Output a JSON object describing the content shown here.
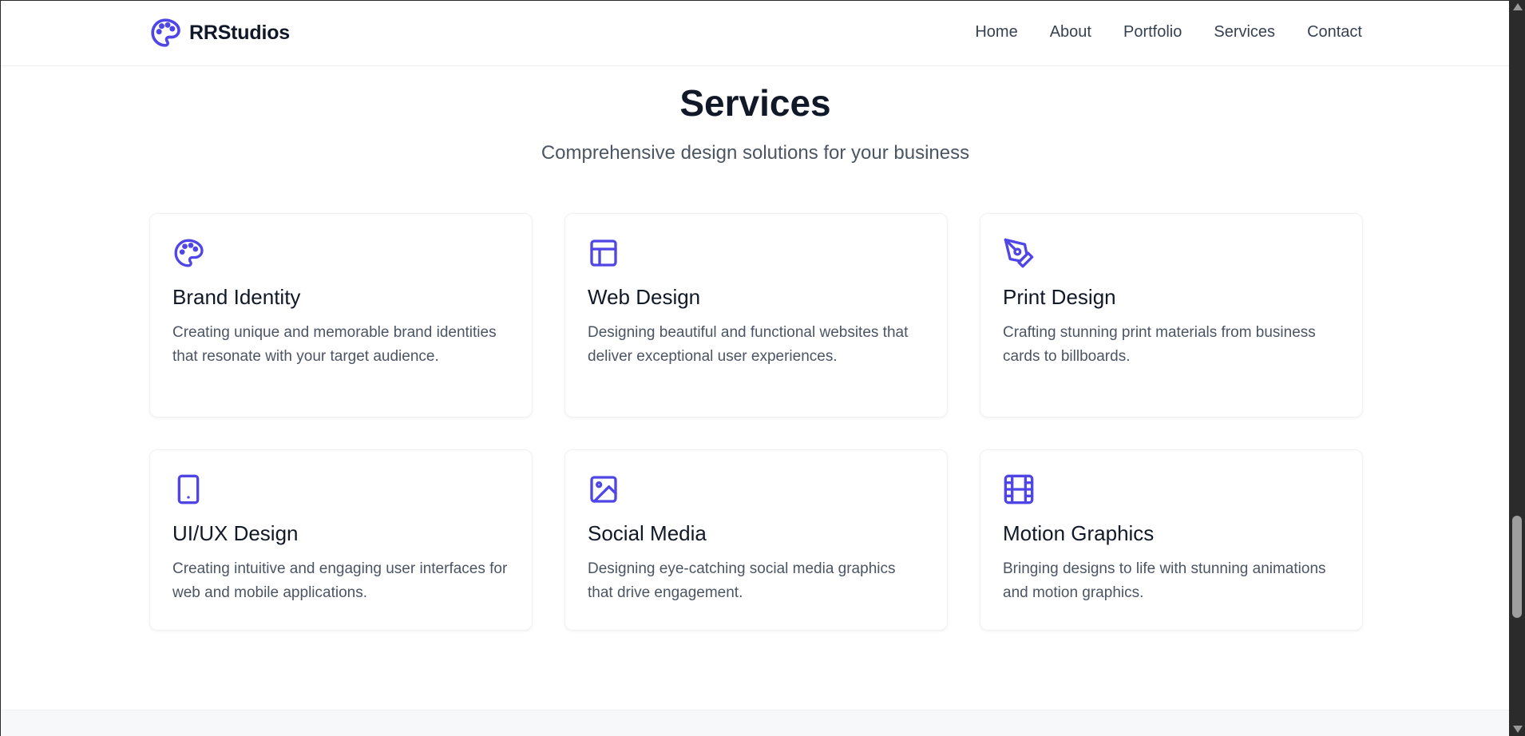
{
  "header": {
    "brand_name": "RRStudios",
    "brand_icon": "palette-icon",
    "nav": [
      {
        "label": "Home"
      },
      {
        "label": "About"
      },
      {
        "label": "Portfolio"
      },
      {
        "label": "Services"
      },
      {
        "label": "Contact"
      }
    ]
  },
  "services": {
    "title": "Services",
    "subtitle": "Comprehensive design solutions for your business",
    "cards": [
      {
        "icon": "palette-icon",
        "title": "Brand Identity",
        "description": "Creating unique and memorable brand identities that resonate with your target audience."
      },
      {
        "icon": "layout-icon",
        "title": "Web Design",
        "description": "Designing beautiful and functional websites that deliver exceptional user experiences."
      },
      {
        "icon": "pen-tool-icon",
        "title": "Print Design",
        "description": "Crafting stunning print materials from business cards to billboards."
      },
      {
        "icon": "tablet-icon",
        "title": "UI/UX Design",
        "description": "Creating intuitive and engaging user interfaces for web and mobile applications."
      },
      {
        "icon": "image-icon",
        "title": "Social Media",
        "description": "Designing eye-catching social media graphics that drive engagement."
      },
      {
        "icon": "film-icon",
        "title": "Motion Graphics",
        "description": "Bringing designs to life with stunning animations and motion graphics."
      }
    ]
  },
  "theme": {
    "accent": "#4f46e5",
    "text_primary": "#111827",
    "text_secondary": "#4b5563"
  }
}
